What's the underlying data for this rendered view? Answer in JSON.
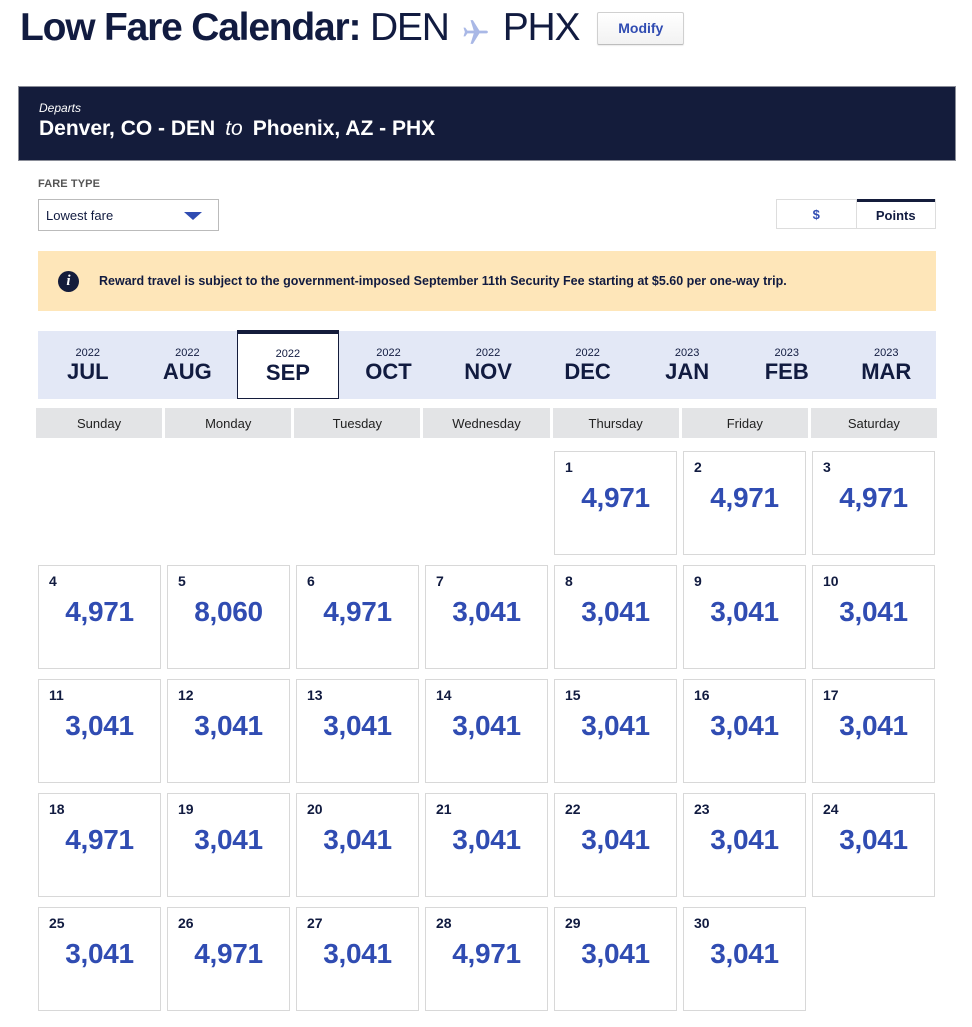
{
  "header": {
    "title_label": "Low Fare Calendar:",
    "origin_code": "DEN",
    "destination_code": "PHX",
    "route_icon": "plane-icon",
    "modify_label": "Modify"
  },
  "route": {
    "departs_label": "Departs",
    "origin": "Denver, CO - DEN",
    "connector": "to",
    "destination": "Phoenix, AZ - PHX"
  },
  "fare_type": {
    "label": "FARE TYPE",
    "selected": "Lowest fare"
  },
  "currency_toggle": {
    "options": [
      "$",
      "Points"
    ],
    "selected": "Points"
  },
  "notice": {
    "icon": "info-icon",
    "icon_glyph": "i",
    "text": "Reward travel is subject to the government-imposed September 11th Security Fee starting at $5.60 per one-way trip."
  },
  "months": [
    {
      "year": "2022",
      "month": "JUL"
    },
    {
      "year": "2022",
      "month": "AUG"
    },
    {
      "year": "2022",
      "month": "SEP",
      "active": true
    },
    {
      "year": "2022",
      "month": "OCT"
    },
    {
      "year": "2022",
      "month": "NOV"
    },
    {
      "year": "2022",
      "month": "DEC"
    },
    {
      "year": "2023",
      "month": "JAN"
    },
    {
      "year": "2023",
      "month": "FEB"
    },
    {
      "year": "2023",
      "month": "MAR"
    }
  ],
  "weekdays": [
    "Sunday",
    "Monday",
    "Tuesday",
    "Wednesday",
    "Thursday",
    "Friday",
    "Saturday"
  ],
  "calendar": {
    "leading_blank_days": 4,
    "days": [
      {
        "day": "1",
        "fare": "4,971"
      },
      {
        "day": "2",
        "fare": "4,971"
      },
      {
        "day": "3",
        "fare": "4,971"
      },
      {
        "day": "4",
        "fare": "4,971"
      },
      {
        "day": "5",
        "fare": "8,060"
      },
      {
        "day": "6",
        "fare": "4,971"
      },
      {
        "day": "7",
        "fare": "3,041"
      },
      {
        "day": "8",
        "fare": "3,041"
      },
      {
        "day": "9",
        "fare": "3,041"
      },
      {
        "day": "10",
        "fare": "3,041"
      },
      {
        "day": "11",
        "fare": "3,041"
      },
      {
        "day": "12",
        "fare": "3,041"
      },
      {
        "day": "13",
        "fare": "3,041"
      },
      {
        "day": "14",
        "fare": "3,041"
      },
      {
        "day": "15",
        "fare": "3,041"
      },
      {
        "day": "16",
        "fare": "3,041"
      },
      {
        "day": "17",
        "fare": "3,041"
      },
      {
        "day": "18",
        "fare": "4,971"
      },
      {
        "day": "19",
        "fare": "3,041"
      },
      {
        "day": "20",
        "fare": "3,041"
      },
      {
        "day": "21",
        "fare": "3,041"
      },
      {
        "day": "22",
        "fare": "3,041"
      },
      {
        "day": "23",
        "fare": "3,041"
      },
      {
        "day": "24",
        "fare": "3,041"
      },
      {
        "day": "25",
        "fare": "3,041"
      },
      {
        "day": "26",
        "fare": "4,971"
      },
      {
        "day": "27",
        "fare": "3,041"
      },
      {
        "day": "28",
        "fare": "4,971"
      },
      {
        "day": "29",
        "fare": "3,041"
      },
      {
        "day": "30",
        "fare": "3,041"
      }
    ]
  },
  "colors": {
    "navy": "#141c3b",
    "fare_blue": "#304cb2",
    "notice_bg": "#fee6b9",
    "month_bar_bg": "#e3e8f6",
    "weekday_bg": "#e3e4e6",
    "plane_icon": "#a9b8e6"
  }
}
